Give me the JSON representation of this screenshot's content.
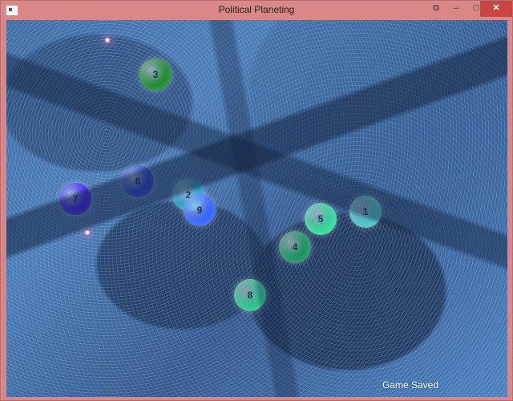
{
  "window": {
    "title": "Political Planeting",
    "buttons": {
      "restore": "⧉",
      "minimize": "–",
      "maximize": "□",
      "close": "✕"
    }
  },
  "game": {
    "status": "Game Saved",
    "stars": [
      "star",
      "star"
    ],
    "planets": [
      {
        "id": "3",
        "color": "#1c8a2c"
      },
      {
        "id": "6",
        "color": "#2242d7"
      },
      {
        "id": "7",
        "color": "#3b1cff"
      },
      {
        "id": "2",
        "color": "#1c98c6"
      },
      {
        "id": "9",
        "color": "#3364ff"
      },
      {
        "id": "5",
        "color": "#2fd69a"
      },
      {
        "id": "1",
        "color": "#46c2c8"
      },
      {
        "id": "4",
        "color": "#17935f"
      },
      {
        "id": "8",
        "color": "#2cc28c"
      }
    ]
  }
}
